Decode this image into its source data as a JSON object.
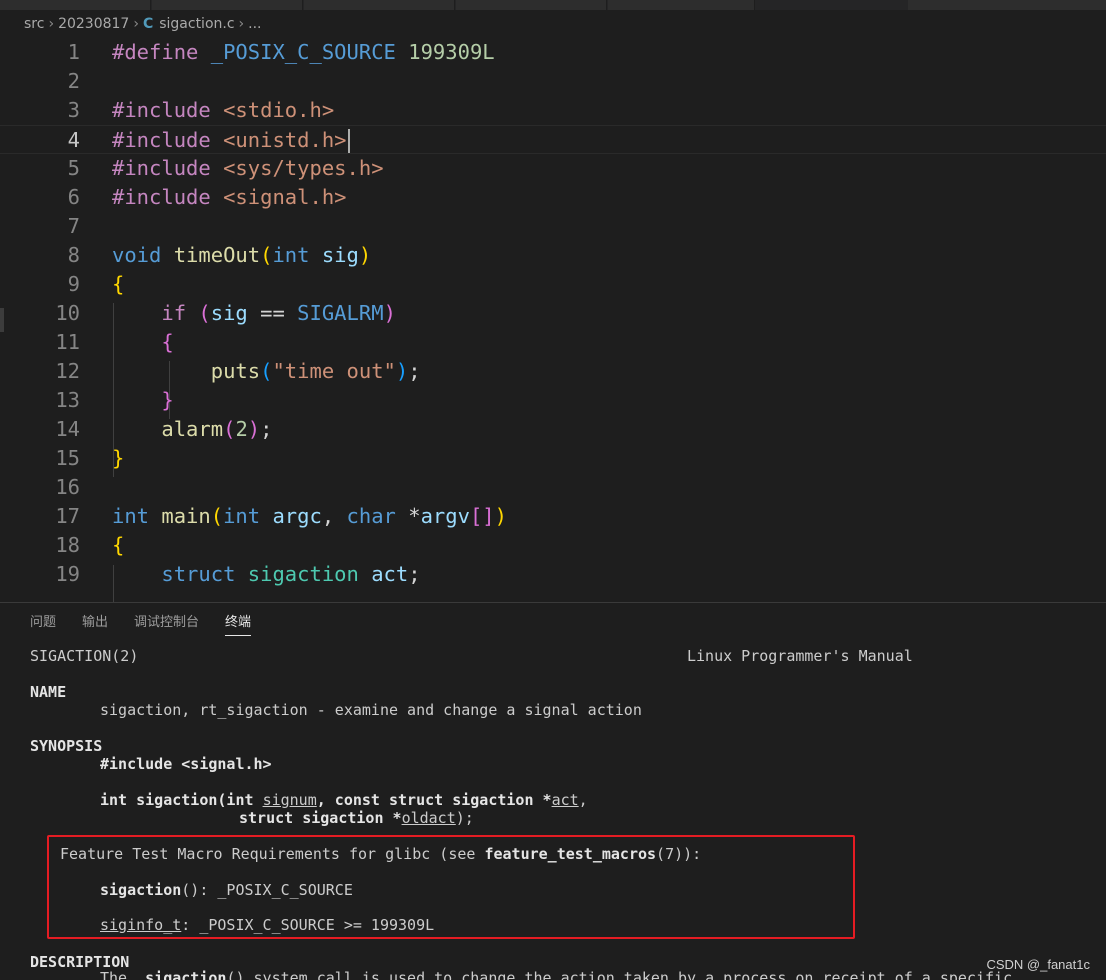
{
  "breadcrumb": {
    "folder1": "src",
    "folder2": "20230817",
    "file_icon": "C",
    "file": "sigaction.c",
    "more": "..."
  },
  "editor": {
    "active_line": 4,
    "lines": [
      {
        "n": "1"
      },
      {
        "n": "2"
      },
      {
        "n": "3"
      },
      {
        "n": "4"
      },
      {
        "n": "5"
      },
      {
        "n": "6"
      },
      {
        "n": "7"
      },
      {
        "n": "8"
      },
      {
        "n": "9"
      },
      {
        "n": "10"
      },
      {
        "n": "11"
      },
      {
        "n": "12"
      },
      {
        "n": "13"
      },
      {
        "n": "14"
      },
      {
        "n": "15"
      },
      {
        "n": "16"
      },
      {
        "n": "17"
      },
      {
        "n": "18"
      },
      {
        "n": "19"
      }
    ],
    "tokens": {
      "define": "#define",
      "posix_macro": "_POSIX_C_SOURCE",
      "posix_value": "199309L",
      "include": "#include",
      "h_stdio": "<stdio.h>",
      "h_unistd": "<unistd.h>",
      "h_types": "<sys/types.h>",
      "h_signal": "<signal.h>",
      "void": "void",
      "timeOut": "timeOut",
      "int": "int",
      "sig": "sig",
      "if": "if",
      "eq": "==",
      "sigalrm": "SIGALRM",
      "puts": "puts",
      "time_out_str": "\"time out\"",
      "alarm": "alarm",
      "two": "2",
      "main": "main",
      "argc": "argc",
      "char": "char",
      "argv": "argv",
      "struct": "struct",
      "sigaction": "sigaction",
      "act": "act"
    }
  },
  "panel": {
    "tabs": [
      "问题",
      "输出",
      "调试控制台",
      "终端"
    ],
    "active_tab": "终端"
  },
  "terminal": {
    "header_left": "SIGACTION(2)",
    "header_right": "Linux Programmer's Manual",
    "name_heading": "NAME",
    "name_line": "sigaction, rt_sigaction - examine and change a signal action",
    "synopsis_heading": "SYNOPSIS",
    "include_line": "#include <signal.h>",
    "proto_int": "int sigaction(int ",
    "proto_signum": "signum",
    "proto_mid": ", const struct sigaction *",
    "proto_act": "act",
    "proto_end": ",",
    "proto2_struct": "struct sigaction *",
    "proto2_oldact": "oldact",
    "proto2_end": ");",
    "ftm_prefix": "Feature Test Macro Requirements for glibc (see ",
    "ftm_bold": "feature_test_macros",
    "ftm_suffix": "(7)):",
    "req1_bold": "sigaction",
    "req1_rest": "(): _POSIX_C_SOURCE",
    "req2_u": "siginfo_t",
    "req2_rest": ": _POSIX_C_SOURCE >= 199309L",
    "description_heading": "DESCRIPTION",
    "desc_the": "The  ",
    "desc_bold": "sigaction",
    "desc_rest": "() system call is used to change the action taken by a process on receipt of a specific"
  },
  "watermark": "CSDN @_fanat1c"
}
